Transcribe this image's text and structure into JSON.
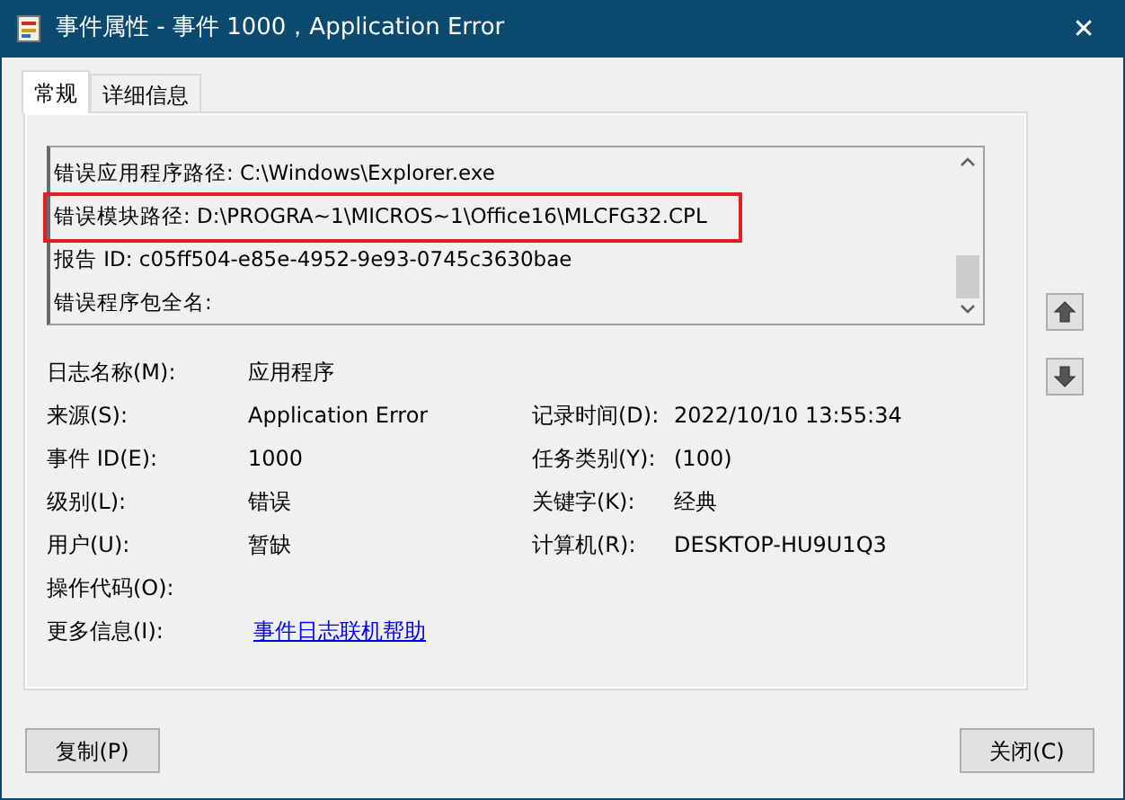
{
  "window": {
    "title": "事件属性 - 事件 1000，Application Error",
    "close": "✕"
  },
  "tabs": [
    {
      "label": "常规",
      "selected": true
    },
    {
      "label": "详细信息",
      "selected": false
    }
  ],
  "description": {
    "lines": [
      {
        "text": "错误应用程序路径: C:\\Windows\\Explorer.exe",
        "highlighted": false
      },
      {
        "text": "错误模块路径: D:\\PROGRA~1\\MICROS~1\\Office16\\MLCFG32.CPL",
        "highlighted": true
      },
      {
        "text": "报告 ID: c05ff504-e85e-4952-9e93-0745c3630bae",
        "highlighted": false
      },
      {
        "text": "错误程序包全名:",
        "highlighted": false
      }
    ]
  },
  "fields": [
    {
      "left": {
        "label": "日志名称(M):",
        "value": "应用程序"
      }
    },
    {
      "left": {
        "label": "来源(S):",
        "value": "Application Error"
      },
      "right": {
        "label": "记录时间(D):",
        "value": "2022/10/10 13:55:34"
      }
    },
    {
      "left": {
        "label": "事件 ID(E):",
        "value": "1000"
      },
      "right": {
        "label": "任务类别(Y):",
        "value": "(100)"
      }
    },
    {
      "left": {
        "label": "级别(L):",
        "value": "错误"
      },
      "right": {
        "label": "关键字(K):",
        "value": "经典"
      }
    },
    {
      "left": {
        "label": "用户(U):",
        "value": "暂缺"
      },
      "right": {
        "label": "计算机(R):",
        "value": "DESKTOP-HU9U1Q3"
      }
    },
    {
      "left": {
        "label": "操作代码(O):"
      }
    },
    {
      "left": {
        "label": "更多信息(I):",
        "value": "事件日志联机帮助",
        "kind": "link"
      }
    }
  ],
  "buttons": [
    {
      "label": "复制(P)"
    },
    {
      "label": "关闭(C)"
    }
  ]
}
